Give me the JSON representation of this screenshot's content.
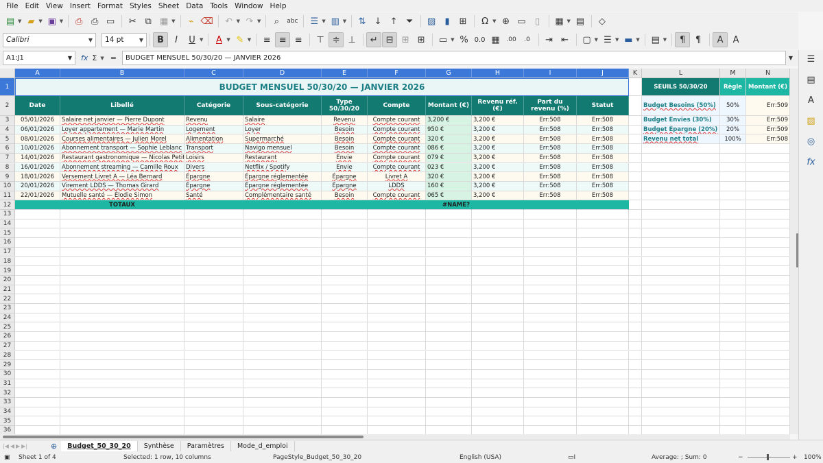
{
  "menu": [
    "File",
    "Edit",
    "View",
    "Insert",
    "Format",
    "Styles",
    "Sheet",
    "Data",
    "Tools",
    "Window",
    "Help"
  ],
  "toolbar": {
    "font_name": "Calibri",
    "font_size": "14 pt"
  },
  "formula_bar": {
    "name_box": "A1:J1",
    "content": "BUDGET MENSUEL 50/30/20 — JANVIER 2026"
  },
  "columns": [
    "A",
    "B",
    "C",
    "D",
    "E",
    "F",
    "G",
    "H",
    "I",
    "J",
    "K",
    "L",
    "M",
    "N"
  ],
  "rows": [
    "1",
    "2",
    "3",
    "4",
    "5",
    "6",
    "7",
    "8",
    "9",
    "10",
    "11",
    "12",
    "13",
    "14",
    "15",
    "16",
    "17",
    "18",
    "19",
    "20",
    "21",
    "22",
    "23",
    "24",
    "25",
    "26",
    "27",
    "28",
    "29",
    "30",
    "31",
    "32",
    "33",
    "34",
    "35",
    "36"
  ],
  "sheet": {
    "title": "BUDGET MENSUEL 50/30/20 — JANVIER 2026",
    "headers": [
      "Date",
      "Libellé",
      "Catégorie",
      "Sous-catégorie",
      "Type 50/30/20",
      "Compte",
      "Montant (€)",
      "Revenu réf. (€)",
      "Part du revenu (%)",
      "Statut"
    ],
    "rows": [
      [
        "05/01/2026",
        "Salaire net janvier — Pierre Dupont",
        "Revenu",
        "Salaire",
        "Revenu",
        "Compte courant",
        "3,200 €",
        "3,200 €",
        "Err:508",
        "Err:508"
      ],
      [
        "06/01/2026",
        "Loyer appartement — Marie Martin",
        "Logement",
        "Loyer",
        "Besoin",
        "Compte courant",
        "950 €",
        "3,200 €",
        "Err:508",
        "Err:508"
      ],
      [
        "08/01/2026",
        "Courses alimentaires — Julien Morel",
        "Alimentation",
        "Supermarché",
        "Besoin",
        "Compte courant",
        "320 €",
        "3,200 €",
        "Err:508",
        "Err:508"
      ],
      [
        "10/01/2026",
        "Abonnement transport — Sophie Leblanc",
        "Transport",
        "Navigo mensuel",
        "Besoin",
        "Compte courant",
        "086 €",
        "3,200 €",
        "Err:508",
        "Err:508"
      ],
      [
        "14/01/2026",
        "Restaurant gastronomique — Nicolas Petit",
        "Loisirs",
        "Restaurant",
        "Envie",
        "Compte courant",
        "079 €",
        "3,200 €",
        "Err:508",
        "Err:508"
      ],
      [
        "16/01/2026",
        "Abonnement streaming — Camille Roux",
        "Divers",
        "Netflix / Spotify",
        "Envie",
        "Compte courant",
        "023 €",
        "3,200 €",
        "Err:508",
        "Err:508"
      ],
      [
        "18/01/2026",
        "Versement Livret A — Léa Bernard",
        "Épargne",
        "Épargne réglementée",
        "Épargne",
        "Livret A",
        "320 €",
        "3,200 €",
        "Err:508",
        "Err:508"
      ],
      [
        "20/01/2026",
        "Virement LDDS — Thomas Girard",
        "Épargne",
        "Épargne réglementée",
        "Épargne",
        "LDDS",
        "160 €",
        "3,200 €",
        "Err:508",
        "Err:508"
      ],
      [
        "22/01/2026",
        "Mutuelle santé — Élodie Simon",
        "Santé",
        "Complémentaire santé",
        "Besoin",
        "Compte courant",
        "065 €",
        "3,200 €",
        "Err:508",
        "Err:508"
      ]
    ],
    "totals_label": "TOTAUX",
    "totals_amount": "#NAME?"
  },
  "thresholds": {
    "title": "SEUILS 50/30/20",
    "col_rule": "Règle",
    "col_amount": "Montant (€)",
    "items": [
      {
        "label": "Budget Besoins (50%)",
        "rule": "50%",
        "amount": "Err:509"
      },
      {
        "label": "Budget Envies (30%)",
        "rule": "30%",
        "amount": "Err:509"
      },
      {
        "label": "Budget Épargne (20%)",
        "rule": "20%",
        "amount": "Err:509"
      },
      {
        "label": "Revenu net total",
        "rule": "100%",
        "amount": "Err:508"
      }
    ]
  },
  "tabs": [
    "Budget_50_30_20",
    "Synthèse",
    "Paramètres",
    "Mode_d_emploi"
  ],
  "status": {
    "sheet": "Sheet 1 of 4",
    "selection": "Selected: 1 row, 10 columns",
    "page_style": "PageStyle_Budget_50_30_20",
    "language": "English (USA)",
    "sum": "Average: ; Sum: 0",
    "zoom": "100%"
  }
}
